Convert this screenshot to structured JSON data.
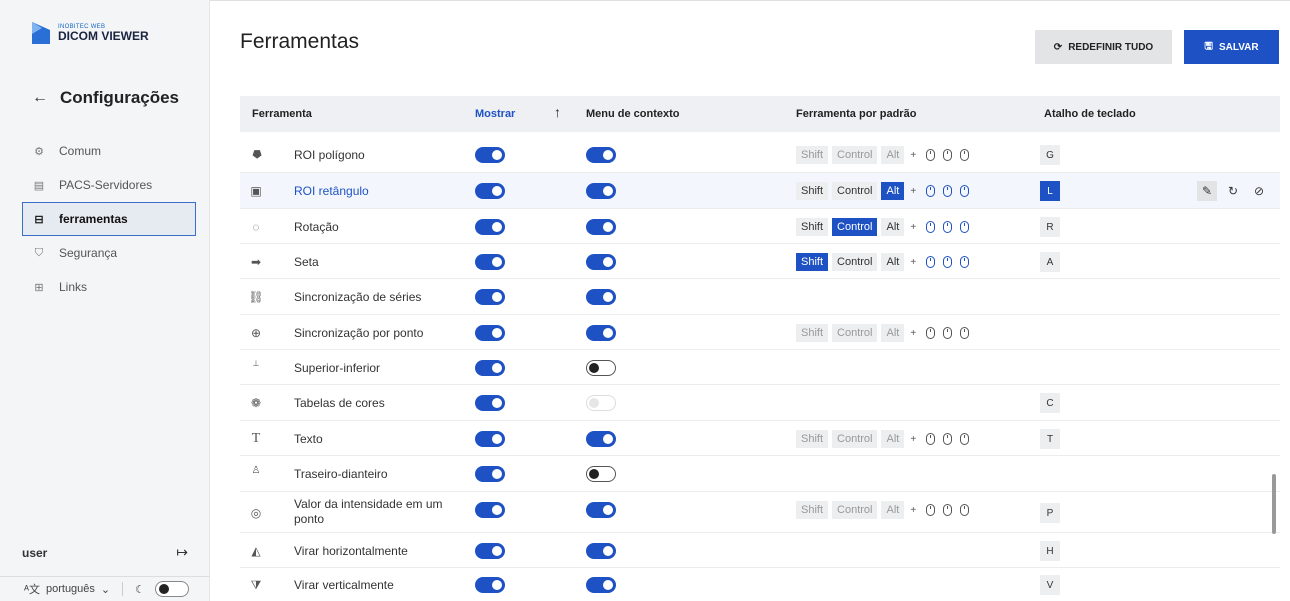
{
  "logo": {
    "small": "INOBITEC WEB",
    "big": "DICOM VIEWER"
  },
  "sidebar": {
    "back_title": "Configurações",
    "items": [
      {
        "label": "Comum",
        "icon": "gear-icon",
        "active": false
      },
      {
        "label": "PACS-Servidores",
        "icon": "server-icon",
        "active": false
      },
      {
        "label": "ferramentas",
        "icon": "toolbox-icon",
        "active": true
      },
      {
        "label": "Segurança",
        "icon": "shield-icon",
        "active": false
      },
      {
        "label": "Links",
        "icon": "link-icon",
        "active": false
      }
    ],
    "user": "user",
    "language": "português"
  },
  "page": {
    "title": "Ferramentas",
    "reset_label": "REDEFINIR TUDO",
    "save_label": "SALVAR"
  },
  "table": {
    "headers": {
      "tool": "Ferramenta",
      "show": "Mostrar",
      "context": "Menu de contexto",
      "default_tool": "Ferramenta por padrão",
      "shortcut": "Atalho de teclado"
    },
    "modifiers": {
      "shift": "Shift",
      "control": "Control",
      "alt": "Alt",
      "plus": "+"
    },
    "rows": [
      {
        "name": "ROI polígono",
        "icon": "polygon-roi-icon",
        "show": "on",
        "context": "on",
        "mods": true,
        "active": false,
        "sel": "",
        "shortcut": "G"
      },
      {
        "name": "ROI retângulo",
        "icon": "rectangle-roi-icon",
        "show": "on",
        "context": "on",
        "mods": true,
        "active": true,
        "sel": "alt",
        "shortcut": "L",
        "highlight": true
      },
      {
        "name": "Rotação",
        "icon": "rotation-icon",
        "show": "on",
        "context": "on",
        "mods": true,
        "active": true,
        "sel": "control",
        "shortcut": "R"
      },
      {
        "name": "Seta",
        "icon": "arrow-icon",
        "show": "on",
        "context": "on",
        "mods": true,
        "active": true,
        "sel": "shift",
        "shortcut": "A"
      },
      {
        "name": "Sincronização de séries",
        "icon": "link-icon",
        "show": "on",
        "context": "on",
        "mods": false,
        "shortcut": ""
      },
      {
        "name": "Sincronização por ponto",
        "icon": "crosshair-icon",
        "show": "on",
        "context": "on",
        "mods": true,
        "active": false,
        "sel": "",
        "shortcut": ""
      },
      {
        "name": "Superior-inferior",
        "icon": "sup-icon",
        "show": "on",
        "context": "off",
        "mods": false,
        "shortcut": ""
      },
      {
        "name": "Tabelas de cores",
        "icon": "palette-icon",
        "show": "on",
        "context": "dis",
        "mods": false,
        "shortcut": "C"
      },
      {
        "name": "Texto",
        "icon": "text-icon",
        "show": "on",
        "context": "on",
        "mods": true,
        "active": false,
        "sel": "",
        "shortcut": "T"
      },
      {
        "name": "Traseiro-dianteiro",
        "icon": "pa-icon",
        "show": "on",
        "context": "off",
        "mods": false,
        "shortcut": ""
      },
      {
        "name": "Valor da intensidade em um ponto",
        "icon": "probe-icon",
        "show": "on",
        "context": "on",
        "mods": true,
        "active": false,
        "sel": "",
        "shortcut": "P"
      },
      {
        "name": "Virar horizontalmente",
        "icon": "flip-horizontal-icon",
        "show": "on",
        "context": "on",
        "mods": false,
        "shortcut": "H"
      },
      {
        "name": "Virar verticalmente",
        "icon": "flip-vertical-icon",
        "show": "on",
        "context": "on",
        "mods": false,
        "shortcut": "V"
      }
    ]
  },
  "colors": {
    "accent": "#1e52c4",
    "sidebar_bg": "#f4f5f7",
    "header_bg": "#eef0f3"
  }
}
